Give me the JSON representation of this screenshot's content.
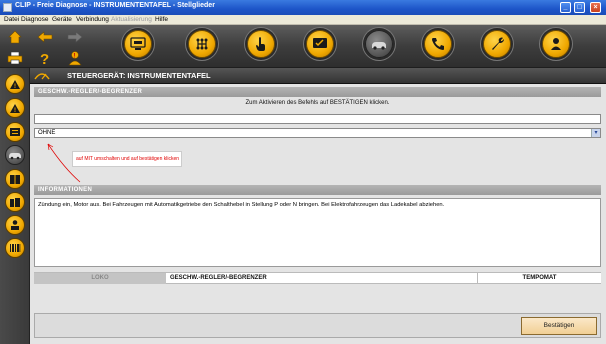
{
  "window": {
    "title": "CLIP - Freie Diagnose - INSTRUMENTENTAFEL - Stellglieder"
  },
  "menu": [
    {
      "label": "Datei",
      "disabled": false
    },
    {
      "label": "Diagnose",
      "disabled": false
    },
    {
      "label": "Geräte",
      "disabled": false
    },
    {
      "label": "Verbindung",
      "disabled": false
    },
    {
      "label": "Aktualisierung",
      "disabled": true
    },
    {
      "label": "Hilfe",
      "disabled": false
    }
  ],
  "toolbar": {
    "buttons": [
      "vehicle-screen-icon",
      "gearbox-icon",
      "touch-hand-icon",
      "check-screen-icon",
      "car-diagnosis-icon",
      "phone-icon",
      "wrench-icon",
      "user-car-icon"
    ]
  },
  "sidebar": {
    "buttons": [
      "warning-icon",
      "warning-icon",
      "screen-list-icon",
      "car-active-icon",
      "book-icon",
      "books-icon",
      "user-print-icon",
      "barcode-icon"
    ]
  },
  "header": {
    "title": "STEUERGERÄT: INSTRUMENTENTAFEL"
  },
  "section1": {
    "heading": "GESCHW.-REGLER/-BEGRENZER",
    "instruction": "Zum Aktivieren des Befehls auf BESTÄTIGEN klicken.",
    "input_value": "",
    "select_value": "OHNE"
  },
  "annotation": {
    "text": "auf MIT umschalten und auf bestätigen klicken"
  },
  "info": {
    "heading": "INFORMATIONEN",
    "text": "Zündung ein, Motor aus. Bei Fahrzeugen mit Automatikgetriebe den Schalthebel in Stellung P oder N bringen. Bei Elektrofahrzeugen das Ladekabel abziehen."
  },
  "tabs": [
    {
      "label": "LOKO",
      "disabled": true
    },
    {
      "label": "GESCHW.-REGLER/-BEGRENZER",
      "disabled": false
    },
    {
      "label": "TEMPOMAT",
      "disabled": false
    }
  ],
  "footer": {
    "confirm_label": "Bestätigen"
  },
  "colors": {
    "accent": "#f0a800",
    "annotation": "#e00000",
    "titlebar": "#1d55c8"
  }
}
